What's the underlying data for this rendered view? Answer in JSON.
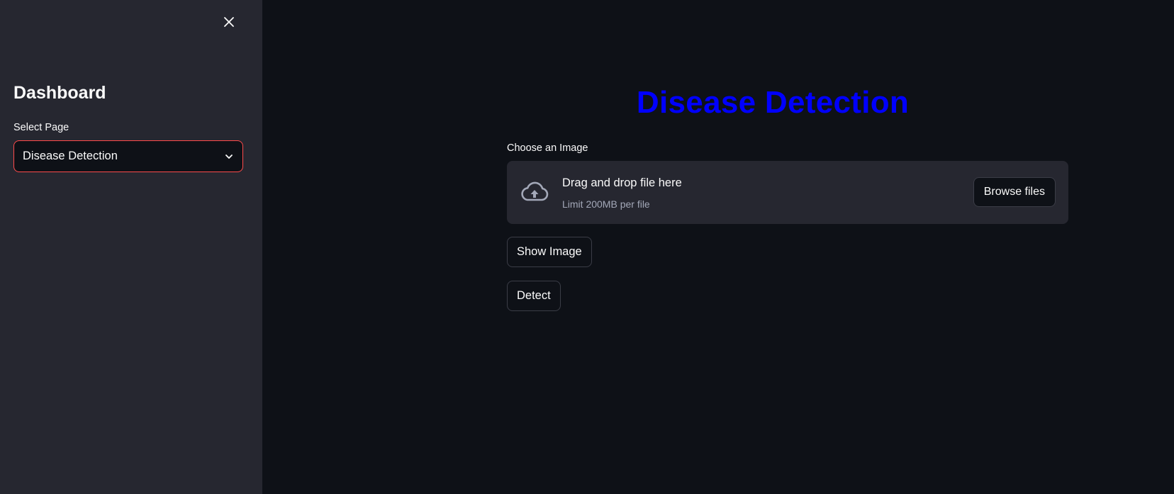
{
  "sidebar": {
    "title": "Dashboard",
    "select_label": "Select Page",
    "select_value": "Disease Detection",
    "close_icon": "close-icon",
    "chevron_icon": "chevron-down-icon"
  },
  "main": {
    "title": "Disease Detection",
    "uploader": {
      "label": "Choose an Image",
      "drop_text": "Drag and drop file here",
      "limit_text": "Limit 200MB per file",
      "browse_label": "Browse files",
      "icon": "cloud-upload-icon"
    },
    "buttons": {
      "show_image": "Show Image",
      "detect": "Detect"
    }
  },
  "colors": {
    "background": "#0e1117",
    "sidebar_background": "#262730",
    "title_color": "#0000ff",
    "select_border": "#ff4b4b",
    "muted_text": "#a3a8b8"
  }
}
